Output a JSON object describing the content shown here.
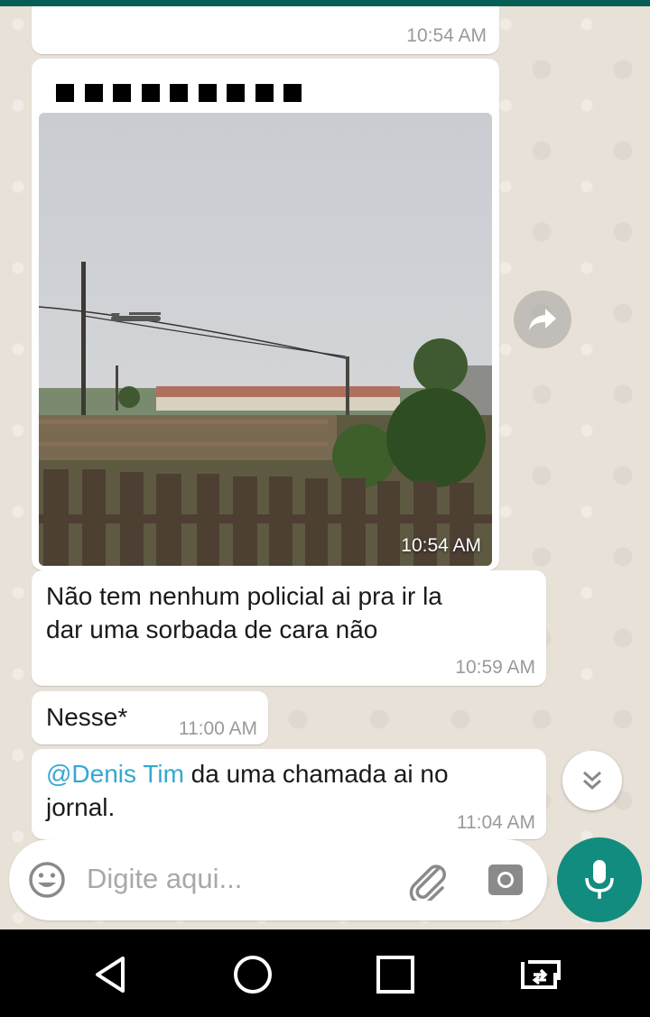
{
  "messages": [
    {
      "time": "10:54 AM"
    },
    {
      "type": "image",
      "photo_time": "10:54 AM"
    },
    {
      "text_line1": "Não tem nenhum policial ai pra ir la",
      "text_line2": "dar uma sorbada de cara não",
      "time": "10:59 AM"
    },
    {
      "text": "Nesse*",
      "time": "11:00 AM"
    },
    {
      "mention": "@Denis Tim",
      "text_rest": " da uma chamada ai no",
      "text_line2": "jornal.",
      "time": "11:04 AM"
    }
  ],
  "composer": {
    "placeholder": "Digite aqui...",
    "emoji_icon": "emoji-icon",
    "attach_icon": "paperclip-icon",
    "camera_icon": "camera-icon",
    "mic_icon": "microphone-icon"
  },
  "icons": {
    "forward": "forward-icon",
    "scroll_down": "double-chevron-down-icon",
    "nav_back": "back-triangle-icon",
    "nav_home": "home-circle-icon",
    "nav_recents": "recents-square-icon",
    "nav_switch": "switch-apps-icon"
  },
  "colors": {
    "accent": "#128c7e",
    "header": "#075e54",
    "mention": "#34a8d1",
    "chat_background": "#e8e1d7"
  }
}
